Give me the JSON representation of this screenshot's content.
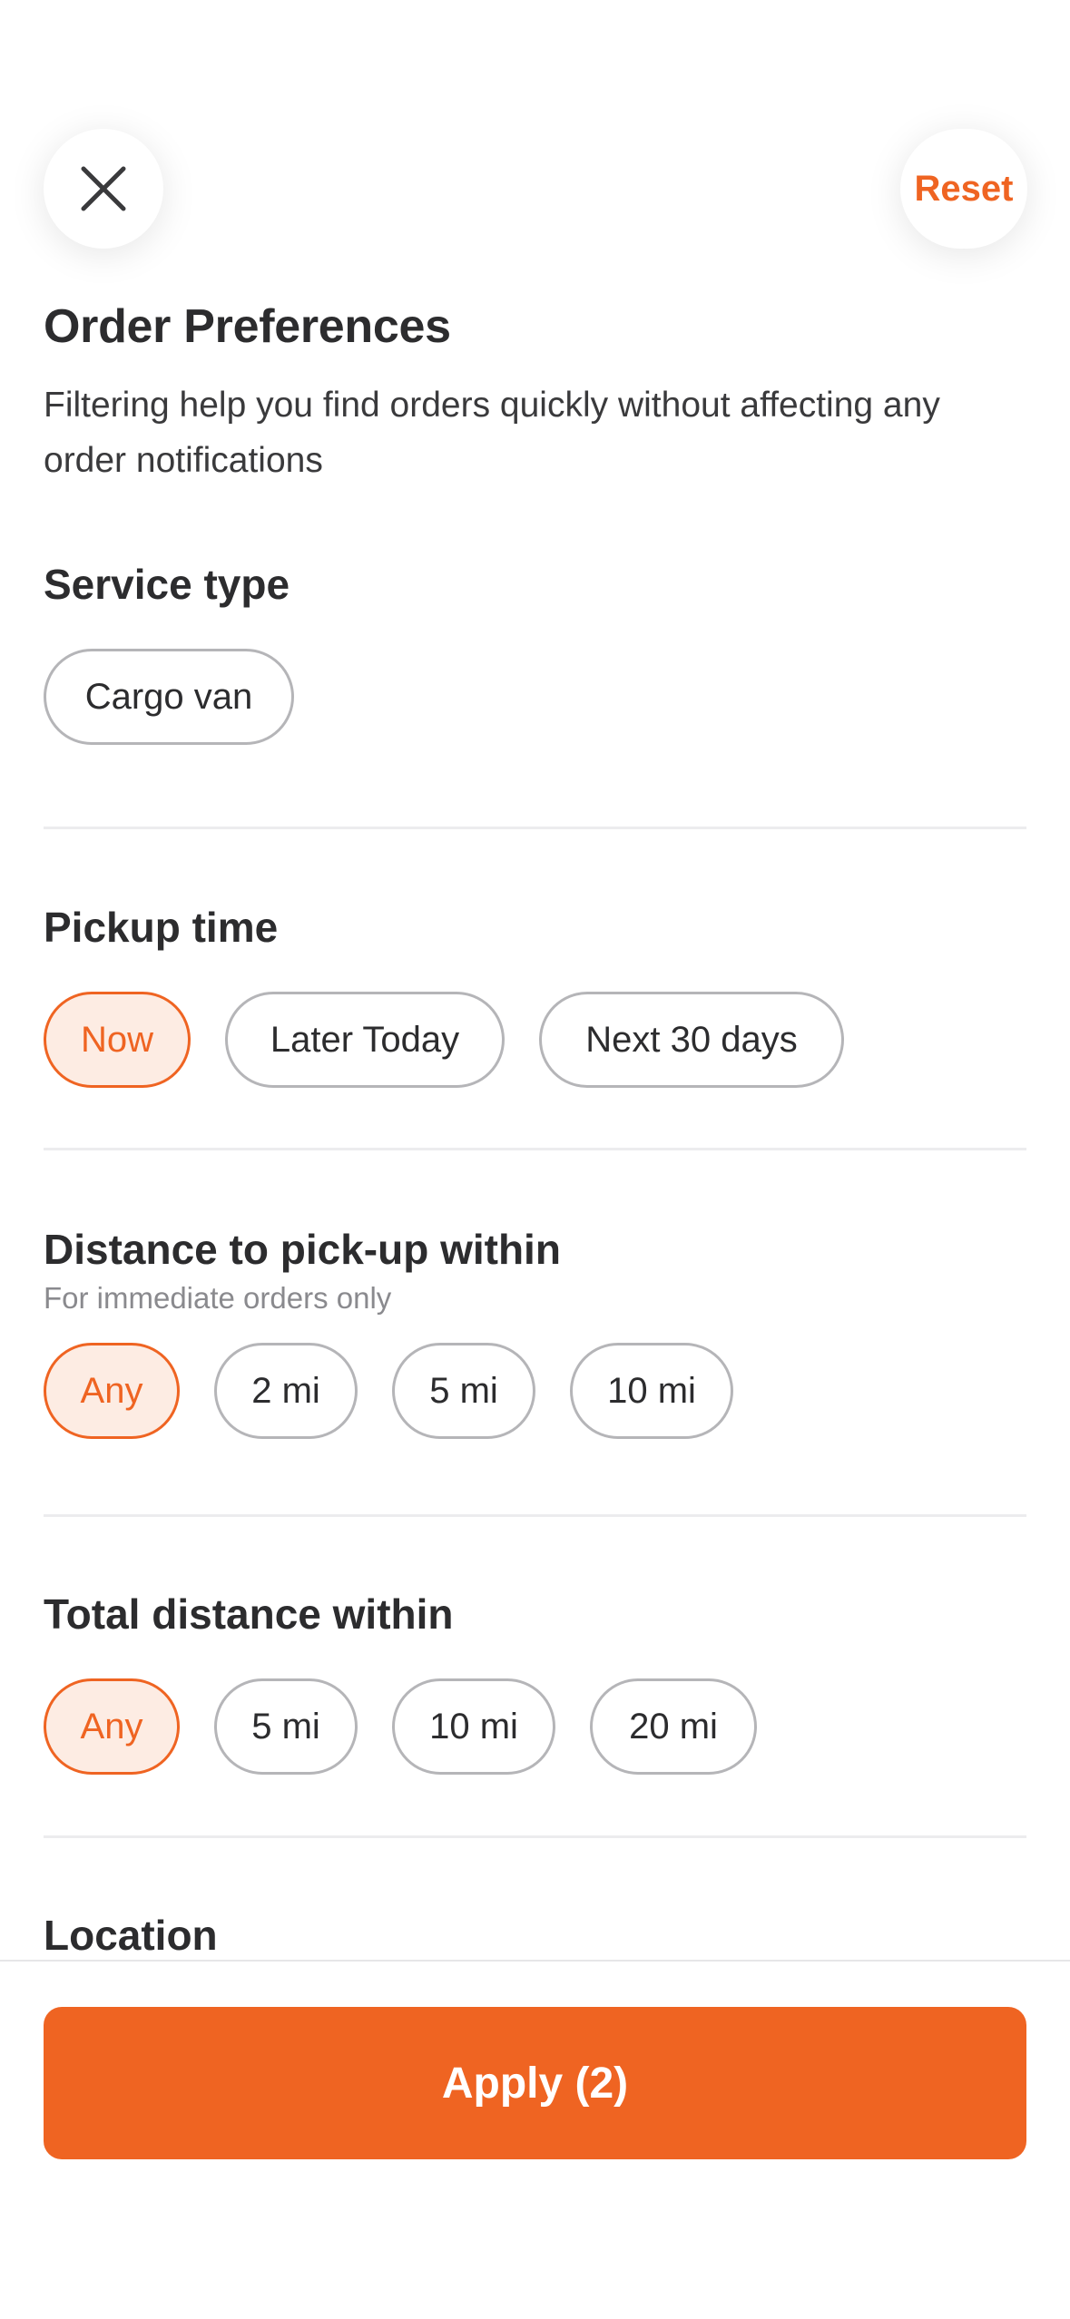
{
  "header": {
    "close_icon": "close-icon",
    "reset_label": "Reset"
  },
  "intro": {
    "title": "Order Preferences",
    "subtitle": "Filtering help you find orders quickly without affecting any order notifications"
  },
  "service_type": {
    "title": "Service type",
    "options": [
      "Cargo van"
    ]
  },
  "pickup_time": {
    "title": "Pickup time",
    "options": [
      "Now",
      "Later Today",
      "Next 30 days"
    ],
    "selected": "Now"
  },
  "pickup_distance": {
    "title": "Distance to pick-up within",
    "subtitle": "For immediate orders only",
    "options": [
      "Any",
      "2 mi",
      "5 mi",
      "10 mi"
    ],
    "selected": "Any"
  },
  "total_distance": {
    "title": "Total distance within",
    "options": [
      "Any",
      "5 mi",
      "10 mi",
      "20 mi"
    ],
    "selected": "Any"
  },
  "location": {
    "title": "Location"
  },
  "footer": {
    "apply_label": "Apply (2)"
  },
  "colors": {
    "accent": "#ef6422",
    "selected_bg": "#fdece3",
    "chip_border": "#b5b5b8"
  }
}
